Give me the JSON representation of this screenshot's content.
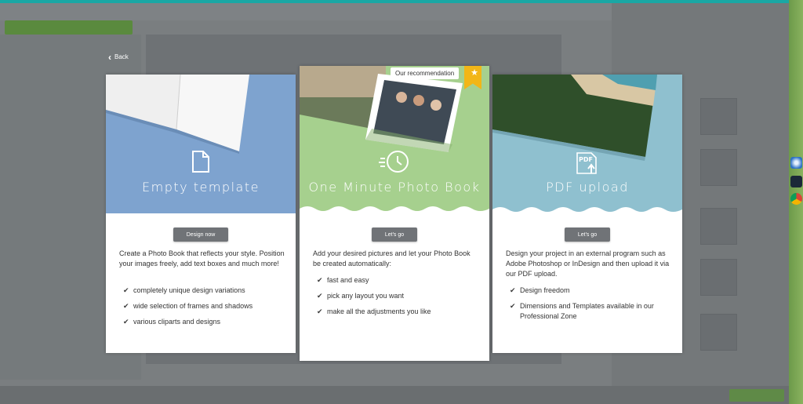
{
  "back_label": "Back",
  "colors": {
    "empty_hero": "#7ea3cf",
    "photo_hero": "#a6d08e",
    "pdf_hero": "#8fc0cf",
    "button": "#707377",
    "ribbon": "#f2b617"
  },
  "cards": {
    "empty": {
      "title": "Empty template",
      "icon": "document-icon",
      "button": "Design now",
      "description": "Create a Photo Book that reflects your style. Position your images freely, add text boxes and much more!",
      "features": [
        "completely unique design variations",
        "wide selection of frames and shadows",
        "various cliparts and designs"
      ]
    },
    "photo": {
      "recommendation": "Our recommendation",
      "title": "One Minute Photo Book",
      "icon": "clock-icon",
      "button": "Let's go",
      "description": "Add your desired pictures and let your Photo Book be created automatically:",
      "features": [
        "fast and easy",
        "pick any layout you want",
        "make all the adjustments you like"
      ]
    },
    "pdf": {
      "title": "PDF upload",
      "icon": "pdf-upload-icon",
      "button": "Let's go",
      "description": "Design your project in an external program such as Adobe Photoshop or InDesign and then upload it via our PDF upload.",
      "features": [
        "Design freedom",
        "Dimensions and Templates available in our Professional Zone"
      ]
    }
  }
}
